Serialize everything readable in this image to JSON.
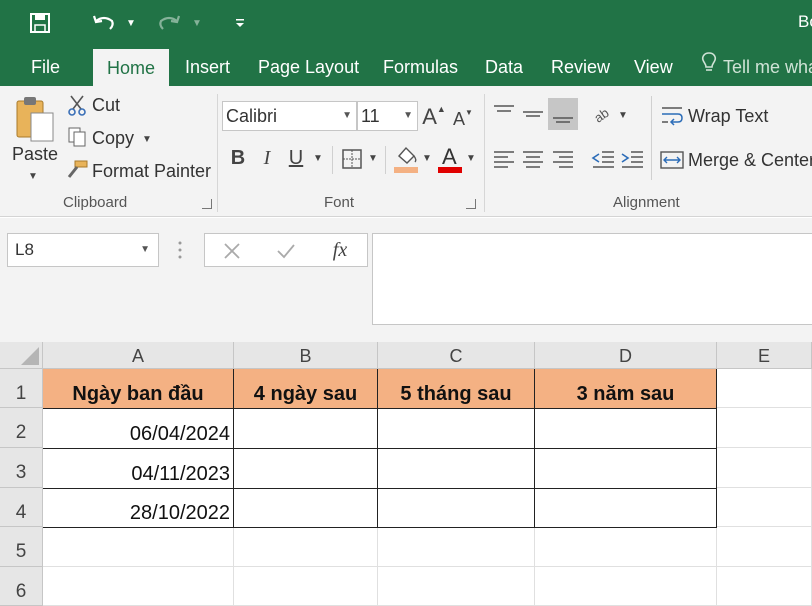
{
  "titlebar": {
    "title": "Bo"
  },
  "tabs": [
    "File",
    "Home",
    "Insert",
    "Page Layout",
    "Formulas",
    "Data",
    "Review",
    "View"
  ],
  "tell_me": "Tell me wha",
  "clipboard": {
    "paste": "Paste",
    "cut": "Cut",
    "copy": "Copy",
    "format_painter": "Format Painter",
    "group_label": "Clipboard"
  },
  "font": {
    "name": "Calibri",
    "size": "11",
    "group_label": "Font",
    "bold": "B",
    "italic": "I",
    "underline": "U",
    "grow": "A",
    "shrink": "A",
    "font_color": "A",
    "colors": {
      "fill": "#f4b183",
      "font": "#e00000"
    }
  },
  "alignment": {
    "wrap_text": "Wrap Text",
    "merge_center": "Merge & Center",
    "group_label": "Alignment"
  },
  "formula_bar": {
    "name_box": "L8",
    "fx": "fx",
    "value": ""
  },
  "sheet": {
    "columns": [
      "A",
      "B",
      "C",
      "D",
      "E"
    ],
    "rows": [
      "1",
      "2",
      "3",
      "4",
      "5",
      "6"
    ],
    "headers": [
      "Ngày ban đầu",
      "4 ngày sau",
      "5 tháng sau",
      "3 năm sau"
    ],
    "dates": [
      "06/04/2024",
      "04/11/2023",
      "28/10/2022"
    ]
  },
  "colors": {
    "accent": "#217346",
    "header_fill": "#f4b183"
  }
}
